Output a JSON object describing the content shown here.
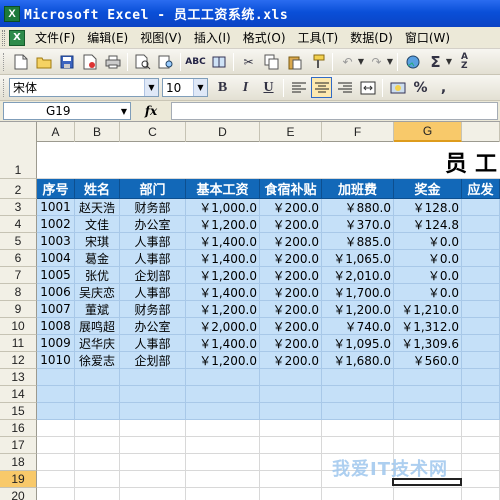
{
  "window": {
    "title": "Microsoft Excel - 员工工资系统.xls",
    "icon": "excel-icon"
  },
  "menubar": {
    "items": [
      "文件(F)",
      "编辑(E)",
      "视图(V)",
      "插入(I)",
      "格式(O)",
      "工具(T)",
      "数据(D)",
      "窗口(W)"
    ]
  },
  "toolbar_format": {
    "font": "宋体",
    "size": "10",
    "bold": "B",
    "italic": "I",
    "underline": "U",
    "percent": "%",
    "comma": ","
  },
  "formula_bar": {
    "cell_ref": "G19",
    "fx": "fx",
    "value": ""
  },
  "columns": [
    "A",
    "B",
    "C",
    "D",
    "E",
    "F",
    "G"
  ],
  "selected_column": "G",
  "selected_row": "19",
  "row_numbers": [
    "1",
    "2",
    "3",
    "4",
    "5",
    "6",
    "7",
    "8",
    "9",
    "10",
    "11",
    "12",
    "13",
    "14",
    "15",
    "16",
    "17",
    "18",
    "19",
    "20"
  ],
  "sheet": {
    "title_partial": "员工",
    "headers": [
      "序号",
      "姓名",
      "部门",
      "基本工资",
      "食宿补贴",
      "加班费",
      "奖金",
      "应发"
    ],
    "rows": [
      [
        "1001",
        "赵天浩",
        "财务部",
        "￥1,000.0",
        "￥200.0",
        "￥880.0",
        "￥128.0"
      ],
      [
        "1002",
        "文佳",
        "办公室",
        "￥1,200.0",
        "￥200.0",
        "￥370.0",
        "￥124.8"
      ],
      [
        "1003",
        "宋琪",
        "人事部",
        "￥1,400.0",
        "￥200.0",
        "￥885.0",
        "￥0.0"
      ],
      [
        "1004",
        "葛金",
        "人事部",
        "￥1,400.0",
        "￥200.0",
        "￥1,065.0",
        "￥0.0"
      ],
      [
        "1005",
        "张优",
        "企划部",
        "￥1,200.0",
        "￥200.0",
        "￥2,010.0",
        "￥0.0"
      ],
      [
        "1006",
        "吴庆恋",
        "人事部",
        "￥1,400.0",
        "￥200.0",
        "￥1,700.0",
        "￥0.0"
      ],
      [
        "1007",
        "董斌",
        "财务部",
        "￥1,200.0",
        "￥200.0",
        "￥1,200.0",
        "￥1,210.0"
      ],
      [
        "1008",
        "展鸣超",
        "办公室",
        "￥2,000.0",
        "￥200.0",
        "￥740.0",
        "￥1,312.0"
      ],
      [
        "1009",
        "迟华庆",
        "人事部",
        "￥1,400.0",
        "￥200.0",
        "￥1,095.0",
        "￥1,309.6"
      ],
      [
        "1010",
        "徐爱志",
        "企划部",
        "￥1,200.0",
        "￥200.0",
        "￥1,680.0",
        "￥560.0"
      ]
    ]
  },
  "watermark": "我爱IT技术网"
}
